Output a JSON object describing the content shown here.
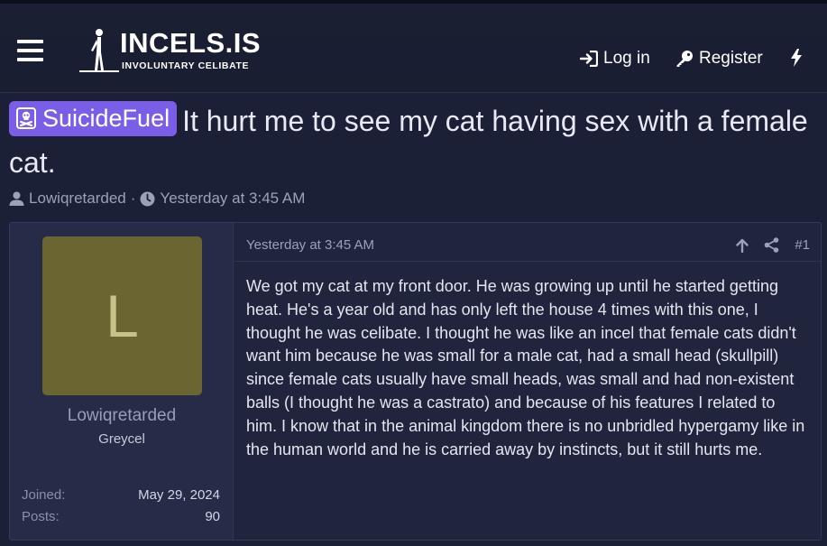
{
  "header": {
    "logo_title": "INCELS.IS",
    "logo_subtitle": "INVOLUNTARY CELIBATE",
    "login_label": "Log in",
    "register_label": "Register",
    "icons": [
      "menu-icon",
      "login-icon",
      "key-icon",
      "bolt-icon"
    ]
  },
  "thread": {
    "prefix": "SuicideFuel",
    "prefix_color": "#7a5ee8",
    "title": "It hurt me to see my cat having sex with a female cat.",
    "author": "Lowiqretarded",
    "separator": "·",
    "date": "Yesterday at 3:45 AM"
  },
  "post": {
    "avatar_letter": "L",
    "avatar_color": "#6b6631",
    "username": "Lowiqretarded",
    "user_title": "Greycel",
    "joined_label": "Joined:",
    "joined_value": "May 29, 2024",
    "posts_label": "Posts:",
    "posts_value": "90",
    "date": "Yesterday at 3:45 AM",
    "number": "#1",
    "body": "We got my cat at my front door. He was growing up until he started getting heat. He's a year old and has only left the house 4 times with this one, I thought he was celibate. I thought he was like an incel that female cats didn't want him because he was small for a male cat, had a small head (skullpill) since female cats usually have small heads, was small and had non-existent balls (I thought he was a castrato) and because of his features I related to him. I know that in the animal kingdom there is no unbridled hypergamy like in the human world and he is carried away by instincts, but it still hurts me."
  },
  "colors": {
    "background": "#1c2036",
    "accent": "#7a5ee8",
    "user_panel": "#262b48"
  }
}
